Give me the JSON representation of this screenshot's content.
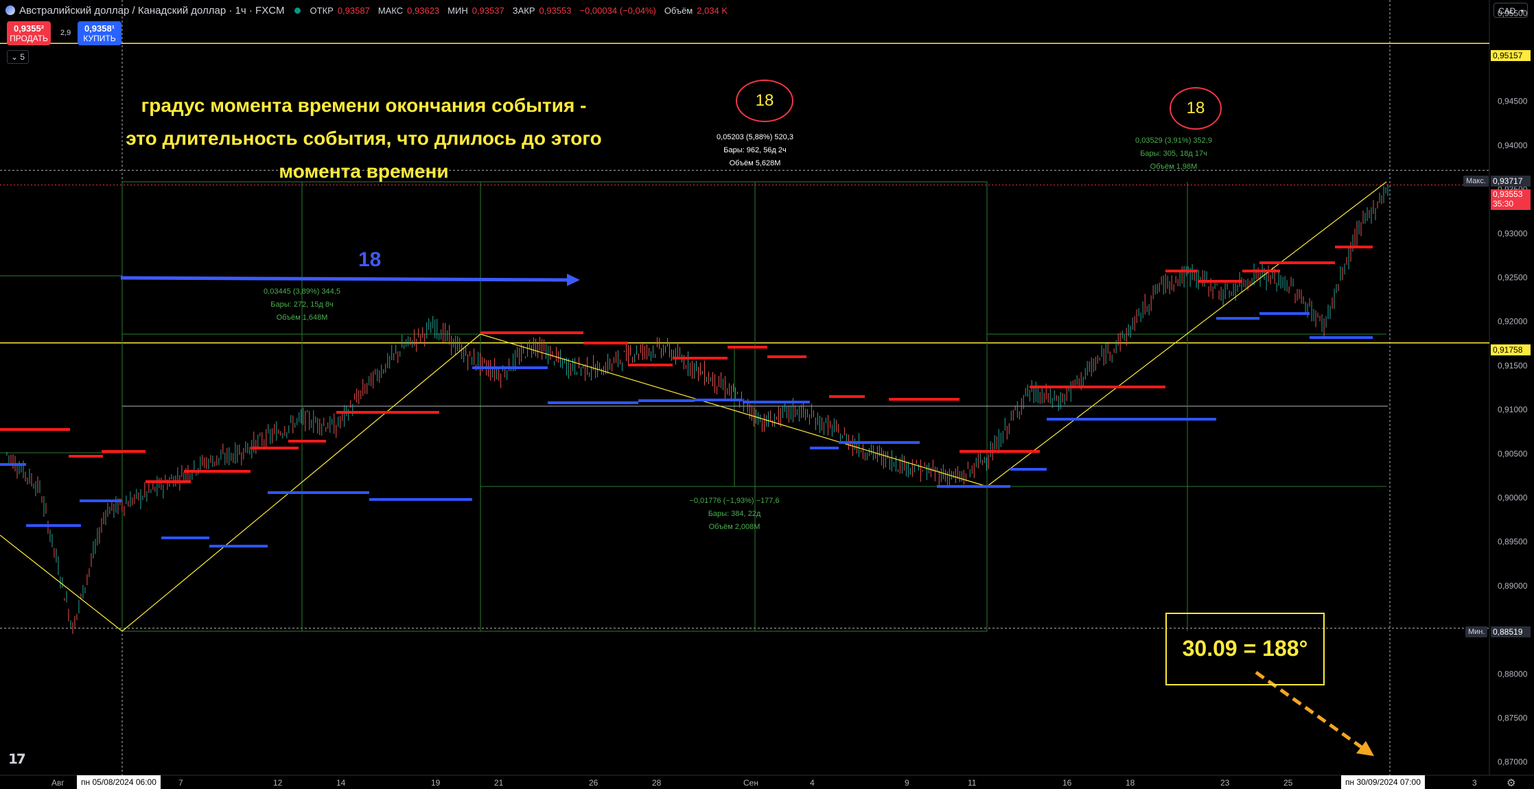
{
  "header": {
    "title": "Австралийский доллар / Канадский доллар · 1ч · FXCM",
    "ohlc": [
      {
        "k": "ОТКР",
        "v": "0,93587"
      },
      {
        "k": "МАКС",
        "v": "0,93623"
      },
      {
        "k": "МИН",
        "v": "0,93537"
      },
      {
        "k": "ЗАКР",
        "v": "0,93553"
      },
      {
        "k": "",
        "v": "−0,00034 (−0,04%)"
      },
      {
        "k": "Объём",
        "v": "2,034 K"
      }
    ],
    "currency": "CAD"
  },
  "trade": {
    "sell_price": "0,9355²",
    "sell_label": "ПРОДАТЬ",
    "spread": "2,9",
    "buy_price": "0,9358¹",
    "buy_label": "КУПИТЬ",
    "collapse_count": "5"
  },
  "annotations": {
    "main_text_lines": [
      "градус момента времени окончания события -",
      "это длительность события, что длилось до этого",
      "момента времени"
    ],
    "circle1": "18",
    "circle2": "18",
    "blue_label": "18",
    "box": "30.09 = 188°"
  },
  "measurements": [
    {
      "lines": [
        "0,03445 (3,89%) 344,5",
        "Бары: 272, 15д 8ч",
        "Объём 1,648M"
      ]
    },
    {
      "lines": [
        "0,05203 (5,88%) 520,3",
        "Бары: 962, 56д 2ч",
        "Объём 5,628M"
      ]
    },
    {
      "lines": [
        "0,03529 (3,91%) 352,9",
        "Бары: 305, 18д 17ч",
        "Объём 1,98M"
      ]
    },
    {
      "lines": [
        "−0,01776 (−1,93%) −177,6",
        "Бары: 384, 22д",
        "Объём 2,008M"
      ]
    }
  ],
  "price_axis": {
    "ticks": [
      "0,95500",
      "0,95000",
      "0,94500",
      "0,94000",
      "0,93500",
      "0,93000",
      "0,92500",
      "0,92000",
      "0,91500",
      "0,91000",
      "0,90500",
      "0,90000",
      "0,89500",
      "0,89000",
      "0,88500",
      "0,88000",
      "0,87500",
      "0,87000"
    ],
    "labels": {
      "hline1": "0,95157",
      "max_tag": "Макс.",
      "max": "0,93717",
      "last": "0,93553",
      "countdown": "35:30",
      "hline2": "0,91758",
      "min_tag": "Мин.",
      "min": "0,88519"
    }
  },
  "time_axis": {
    "ticks": [
      "Авг",
      "7",
      "12",
      "14",
      "19",
      "21",
      "26",
      "28",
      "Сен",
      "4",
      "9",
      "11",
      "16",
      "18",
      "23",
      "25",
      "3"
    ],
    "cross_left": "пн 05/08/2024  06:00",
    "cross_right": "пн 30/09/2024  07:00"
  },
  "chart_data": {
    "type": "line",
    "title": "Австралийский доллар / Канадский доллар · 1ч · FXCM",
    "series": [
      {
        "name": "Австралийский доллар / Канадский доллар",
        "x": [
          "01/08",
          "02/08",
          "05/08",
          "06/08",
          "07/08",
          "08/08",
          "09/08",
          "12/08",
          "13/08",
          "14/08",
          "15/08",
          "16/08",
          "19/08",
          "20/08",
          "21/08",
          "22/08",
          "23/08",
          "26/08",
          "27/08",
          "28/08",
          "29/08",
          "30/08",
          "02/09",
          "03/09",
          "04/09",
          "05/09",
          "06/09",
          "09/09",
          "10/09",
          "11/09",
          "12/09",
          "13/09",
          "16/09",
          "17/09",
          "18/09",
          "19/09",
          "20/09",
          "23/09",
          "24/09",
          "25/09",
          "26/09",
          "27/09",
          "30/09"
        ],
        "values": [
          0.905,
          0.901,
          0.8852,
          0.8985,
          0.9,
          0.902,
          0.904,
          0.905,
          0.907,
          0.909,
          0.908,
          0.913,
          0.917,
          0.9195,
          0.916,
          0.914,
          0.9175,
          0.915,
          0.9145,
          0.9165,
          0.917,
          0.9145,
          0.912,
          0.9085,
          0.91,
          0.908,
          0.9055,
          0.904,
          0.903,
          0.9022,
          0.9055,
          0.912,
          0.911,
          0.915,
          0.9185,
          0.924,
          0.9255,
          0.923,
          0.9255,
          0.924,
          0.9195,
          0.93,
          0.9355
        ]
      }
    ],
    "ylim": [
      0.8685,
      0.9565
    ],
    "reference_lines": [
      0.95157,
      0.93717,
      0.91758,
      0.88519
    ]
  }
}
